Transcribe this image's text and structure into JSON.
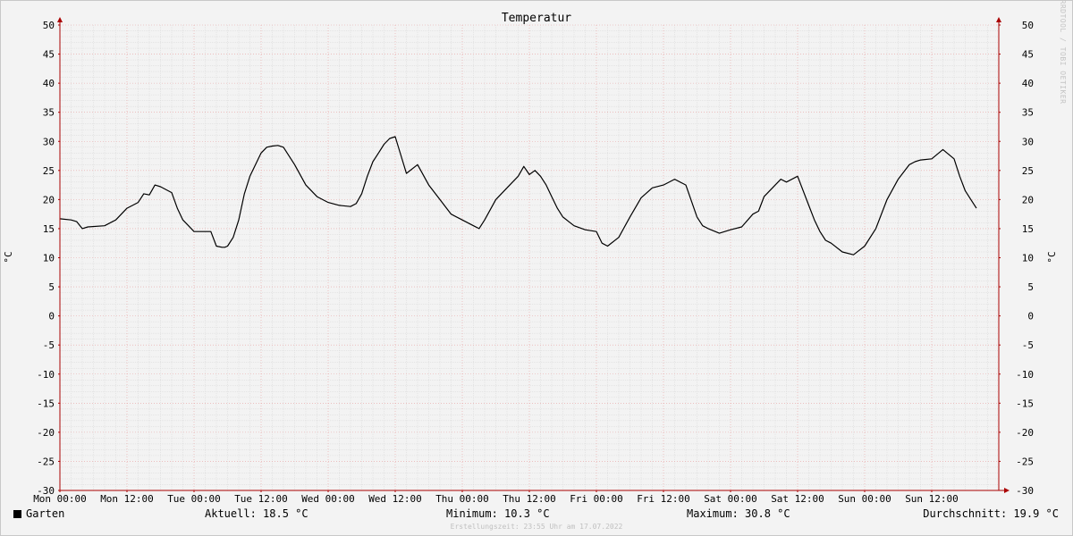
{
  "chart_data": {
    "type": "line",
    "title": "Temperatur",
    "ylabel": "°C",
    "y2label": "°C",
    "ylim": [
      -30,
      50
    ],
    "y_ticks": [
      50,
      45,
      40,
      35,
      30,
      25,
      20,
      15,
      10,
      5,
      0,
      -5,
      -10,
      -15,
      -20,
      -25,
      -30
    ],
    "x_tick_labels": [
      "Mon 00:00",
      "Mon 12:00",
      "Tue 00:00",
      "Tue 12:00",
      "Wed 00:00",
      "Wed 12:00",
      "Thu 00:00",
      "Thu 12:00",
      "Fri 00:00",
      "Fri 12:00",
      "Sat 00:00",
      "Sat 12:00",
      "Sun 00:00",
      "Sun 12:00"
    ],
    "xlim_hours": [
      0,
      168
    ],
    "grid": true,
    "series": [
      {
        "name": "Garten",
        "color": "#000000",
        "x_hours": [
          0,
          2,
          3,
          4,
          5,
          8,
          10,
          12,
          14,
          15,
          16,
          17,
          18,
          20,
          21,
          22,
          23,
          24,
          26,
          27,
          28,
          29,
          29.5,
          30,
          31,
          32,
          33,
          34,
          36,
          37,
          38,
          39,
          40,
          42,
          44,
          46,
          48,
          50,
          52,
          53,
          54,
          55,
          56,
          57,
          58,
          59,
          60,
          62,
          64,
          66,
          68,
          70,
          72,
          74,
          75,
          76,
          78,
          80,
          82,
          83,
          84,
          85,
          86,
          87,
          88,
          89,
          90,
          92,
          94,
          96,
          97,
          98,
          100,
          102,
          104,
          106,
          108,
          110,
          112,
          114,
          115,
          116,
          118,
          120,
          122,
          124,
          125,
          126,
          128,
          129,
          130,
          132,
          134,
          135,
          136,
          137,
          138,
          140,
          142,
          144,
          146,
          148,
          150,
          152,
          153,
          154,
          156,
          158,
          160,
          161,
          162,
          163,
          164,
          165,
          166,
          167,
          168
        ],
        "values": [
          16.7,
          16.5,
          16.2,
          15,
          15.3,
          15.5,
          16.5,
          18.5,
          19.5,
          21,
          20.8,
          22.5,
          22.2,
          21.2,
          18.5,
          16.5,
          15.5,
          14.5,
          14.5,
          14.5,
          12,
          11.8,
          11.8,
          12,
          13.5,
          16.5,
          21,
          24,
          28,
          29,
          29.2,
          29.3,
          29.0,
          26,
          22.5,
          20.5,
          19.5,
          19,
          18.8,
          19.3,
          21,
          24,
          26.5,
          28,
          29.5,
          30.5,
          30.8,
          24.5,
          26,
          22.5,
          20,
          17.5,
          16.5,
          15.5,
          15,
          16.5,
          20,
          22,
          24,
          25.7,
          24.3,
          25,
          24,
          22.5,
          20.5,
          18.5,
          17,
          15.5,
          14.8,
          14.5,
          12.5,
          12,
          13.5,
          17,
          20.3,
          22,
          22.5,
          23.5,
          22.5,
          17,
          15.5,
          15,
          14.2,
          14.8,
          15.3,
          17.5,
          18,
          20.5,
          22.5,
          23.5,
          23,
          24,
          19,
          16.5,
          14.5,
          13,
          12.5,
          11,
          10.5,
          12,
          15,
          20,
          23.5,
          26,
          26.5,
          26.8,
          27,
          28.6,
          27,
          24,
          21.5,
          20,
          18.5
        ]
      }
    ],
    "legend": {
      "series_name": "Garten",
      "current": "Aktuell: 18.5 °C",
      "minimum": "Minimum: 10.3 °C",
      "maximum": "Maximum: 30.8 °C",
      "average": "Durchschnitt: 19.9 °C"
    },
    "watermark": "RRDTOOL / TOBI OETIKER",
    "footer": "Erstellungszeit: 23:55 Uhr am 17.07.2022"
  }
}
